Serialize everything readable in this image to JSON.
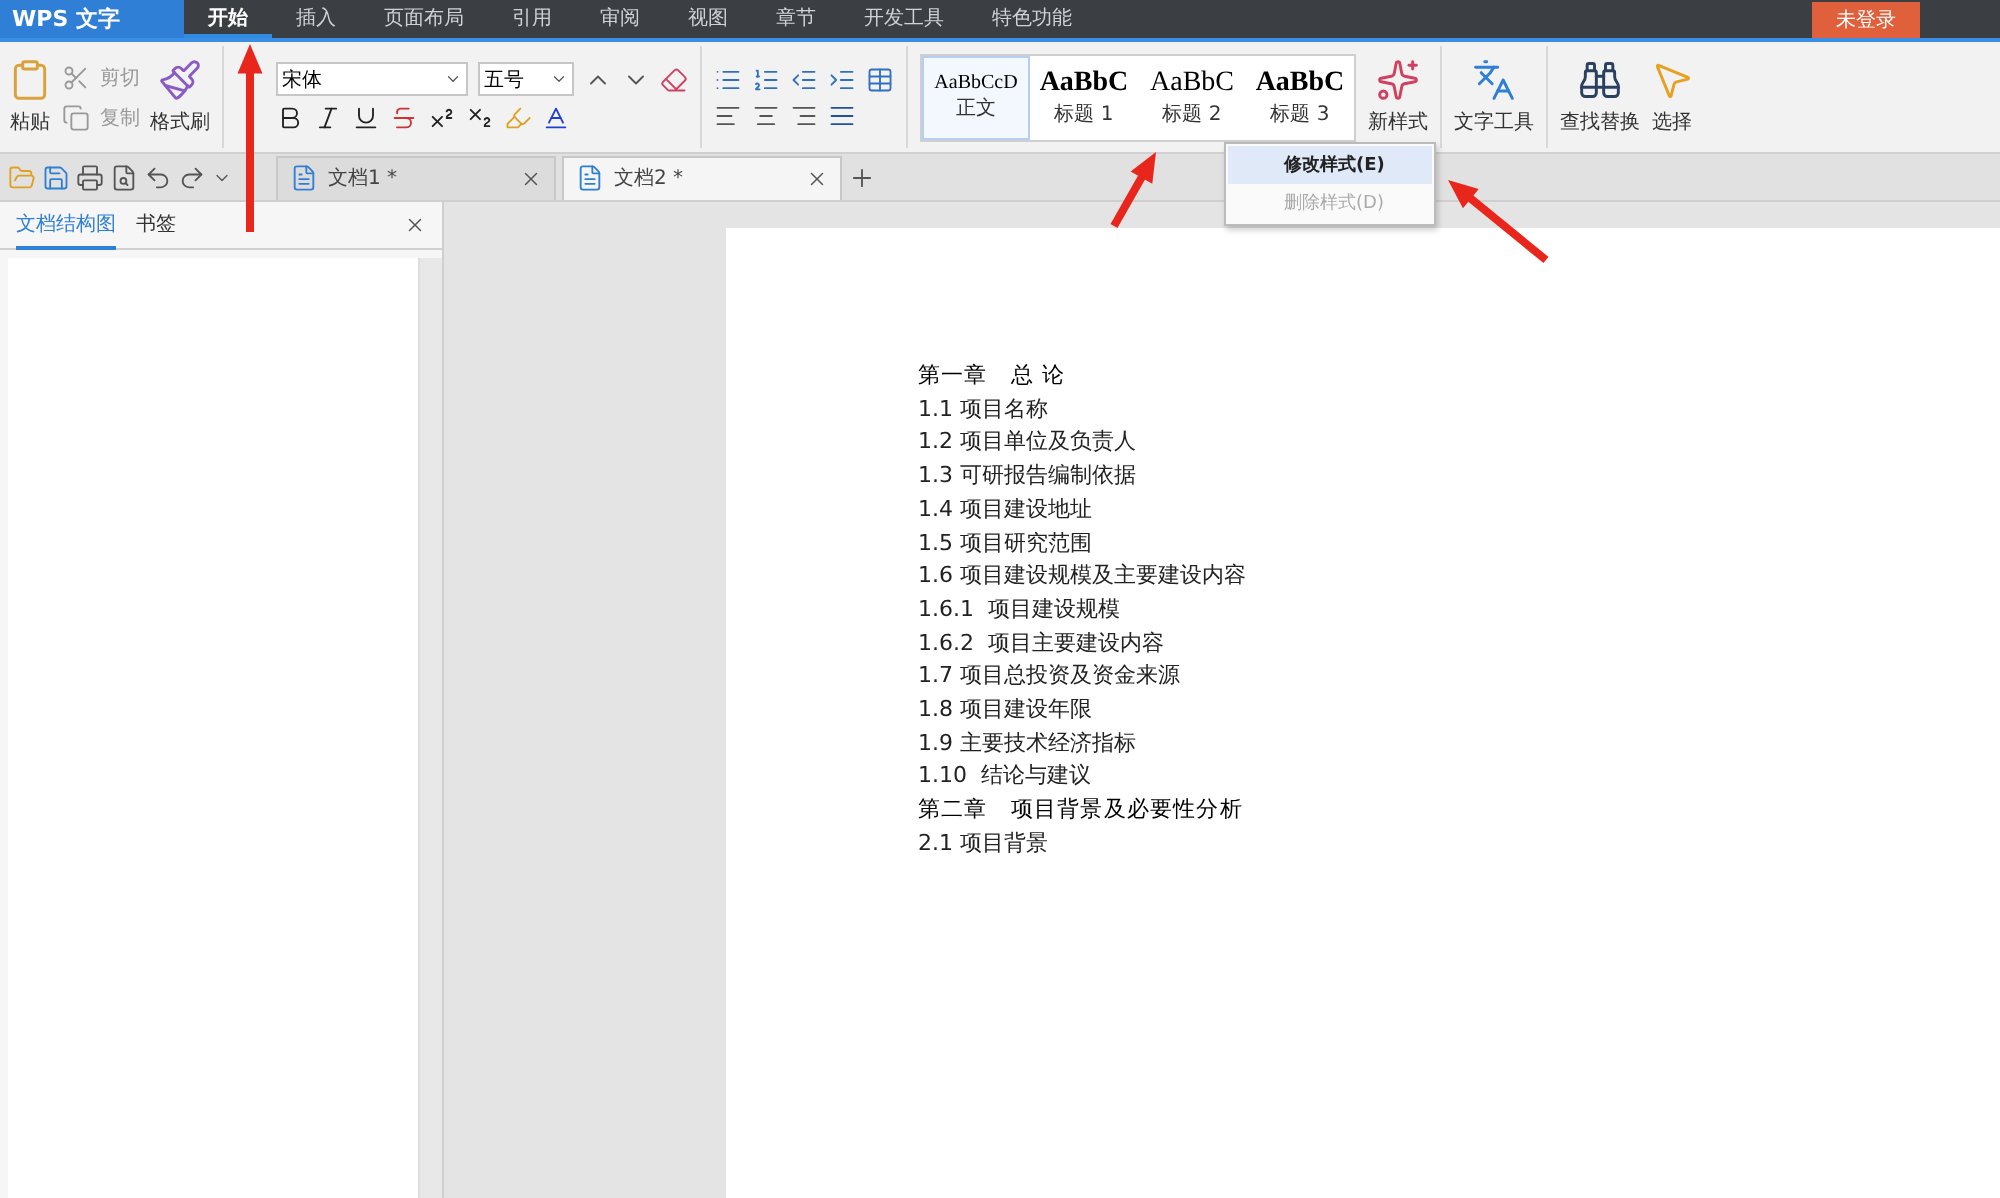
{
  "app": {
    "name": "WPS 文字"
  },
  "menu_tabs": [
    {
      "label": "开始",
      "selected": true
    },
    {
      "label": "插入",
      "selected": false
    },
    {
      "label": "页面布局",
      "selected": false
    },
    {
      "label": "引用",
      "selected": false
    },
    {
      "label": "审阅",
      "selected": false
    },
    {
      "label": "视图",
      "selected": false
    },
    {
      "label": "章节",
      "selected": false
    },
    {
      "label": "开发工具",
      "selected": false
    },
    {
      "label": "特色功能",
      "selected": false
    }
  ],
  "login": "未登录",
  "ribbon": {
    "cut": "剪切",
    "copy": "复制",
    "paste": "粘贴",
    "format_painter": "格式刷",
    "font": "宋体",
    "font_size": "五号",
    "styles": [
      {
        "preview": "AaBbCcD",
        "label": "正文",
        "kind": "normal",
        "selected": true
      },
      {
        "preview": "AaBbC",
        "label": "标题 1",
        "kind": "h1",
        "selected": false
      },
      {
        "preview": "AaBbC",
        "label": "标题 2",
        "kind": "h2",
        "selected": false
      },
      {
        "preview": "AaBbC",
        "label": "标题 3",
        "kind": "h3",
        "selected": false
      }
    ],
    "new_style": "新样式",
    "text_tools": "文字工具",
    "find_replace": "查找替换",
    "select": "选择"
  },
  "context_menu": [
    {
      "label": "修改样式(E)",
      "selected": true,
      "disabled": false
    },
    {
      "label": "删除样式(D)",
      "selected": false,
      "disabled": true
    }
  ],
  "doc_tabs": [
    {
      "label": "文档1 *",
      "selected": false
    },
    {
      "label": "文档2 *",
      "selected": true
    }
  ],
  "side_panel": {
    "tabs": [
      {
        "label": "文档结构图",
        "selected": true
      },
      {
        "label": "书签",
        "selected": false
      }
    ]
  },
  "document": [
    {
      "text": "第一章　总 论",
      "kind": "chapter"
    },
    {
      "text": "1.1 项目名称",
      "kind": "section"
    },
    {
      "text": "1.2 项目单位及负责人",
      "kind": "section"
    },
    {
      "text": "1.3 可研报告编制依据",
      "kind": "section"
    },
    {
      "text": "1.4 项目建设地址",
      "kind": "section"
    },
    {
      "text": "1.5 项目研究范围",
      "kind": "section"
    },
    {
      "text": "1.6 项目建设规模及主要建设内容",
      "kind": "section"
    },
    {
      "text": "1.6.1  项目建设规模",
      "kind": "section"
    },
    {
      "text": "1.6.2  项目主要建设内容",
      "kind": "section"
    },
    {
      "text": "1.7 项目总投资及资金来源",
      "kind": "section"
    },
    {
      "text": "1.8 项目建设年限",
      "kind": "section"
    },
    {
      "text": "1.9 主要技术经济指标",
      "kind": "section"
    },
    {
      "text": "1.10  结论与建议",
      "kind": "section"
    },
    {
      "text": "第二章　项目背景及必要性分析",
      "kind": "chapter"
    },
    {
      "text": "2.1 项目背景",
      "kind": "section"
    }
  ]
}
